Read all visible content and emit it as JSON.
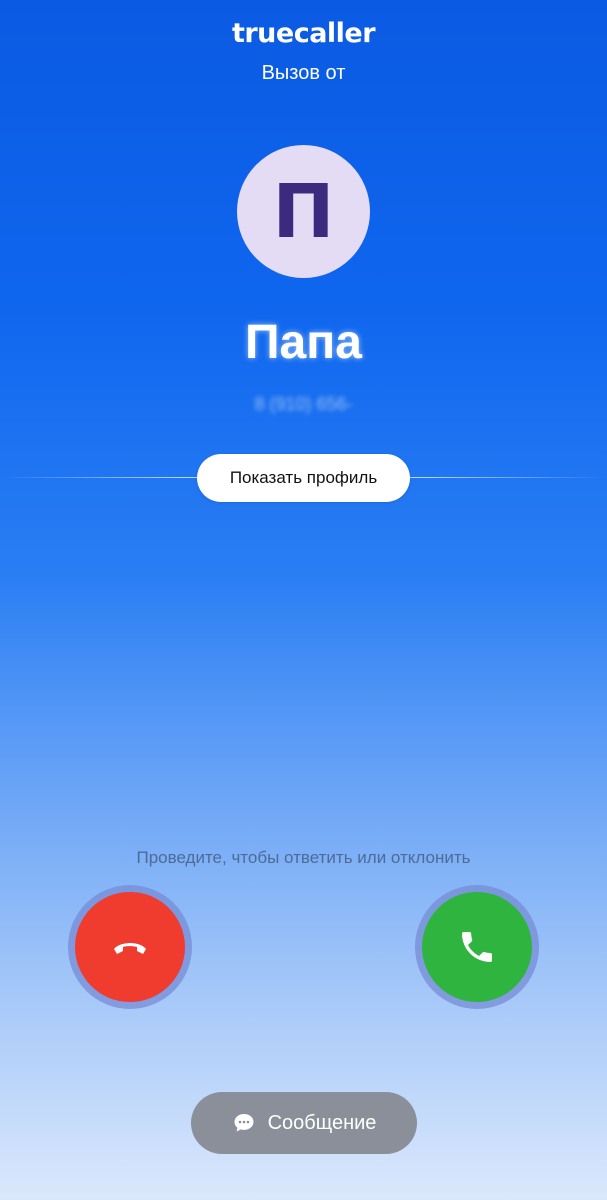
{
  "app": {
    "brand": "truecaller",
    "subtitle": "Вызов от"
  },
  "caller": {
    "avatar_letter": "П",
    "name": "Папа",
    "number": "8 (910) 656-"
  },
  "actions": {
    "show_profile_label": "Показать профиль",
    "swipe_hint": "Проведите, чтобы ответить или отклонить",
    "decline_icon": "phone-hangup-icon",
    "accept_icon": "phone-icon",
    "message_label": "Сообщение",
    "message_icon": "chat-bubble-icon"
  },
  "colors": {
    "decline": "#f03b2f",
    "accept": "#2fb53f",
    "avatar_bg": "#e4dcf4",
    "avatar_letter": "#3b2a7e",
    "message_button": "#8a8f99"
  }
}
